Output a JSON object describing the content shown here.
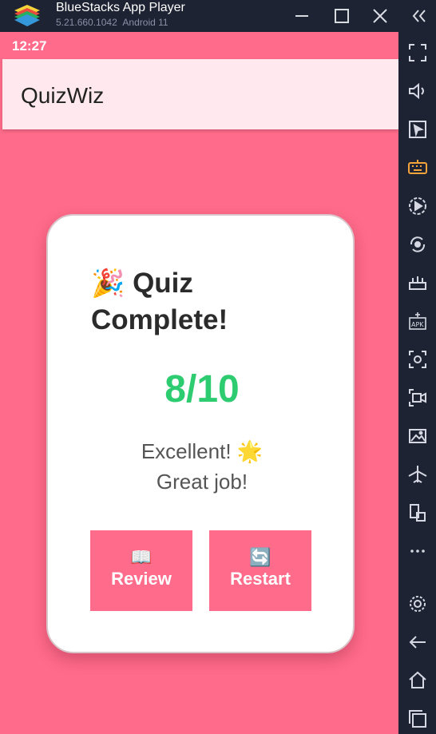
{
  "window": {
    "title": "BlueStacks App Player",
    "version": "5.21.660.1042",
    "android": "Android 11"
  },
  "status": {
    "time": "12:27"
  },
  "app": {
    "title": "QuizWiz"
  },
  "result": {
    "title_emoji": "🎉",
    "title": "Quiz Complete!",
    "score": "8/10",
    "message_line1": "Excellent! 🌟",
    "message_line2": "Great job!"
  },
  "buttons": {
    "review_emoji": "📖",
    "review_label": "Review",
    "restart_emoji": "🔄",
    "restart_label": "Restart"
  },
  "colors": {
    "screen_bg": "#ff6b8a",
    "appbar_bg": "#ffe9ef",
    "score": "#2ecc71",
    "chrome_bg": "#1e2333"
  },
  "sidebar_icons": [
    "fullscreen-icon",
    "volume-icon",
    "pointer-icon",
    "keyboard-icon",
    "macro-play-icon",
    "rotate-icon",
    "performance-icon",
    "apk-install-icon",
    "screenshot-icon",
    "screen-record-icon",
    "media-folder-icon",
    "airplane-mode-icon",
    "multi-instance-icon",
    "more-icon",
    "settings-icon",
    "back-icon",
    "home-icon",
    "recent-apps-icon"
  ]
}
